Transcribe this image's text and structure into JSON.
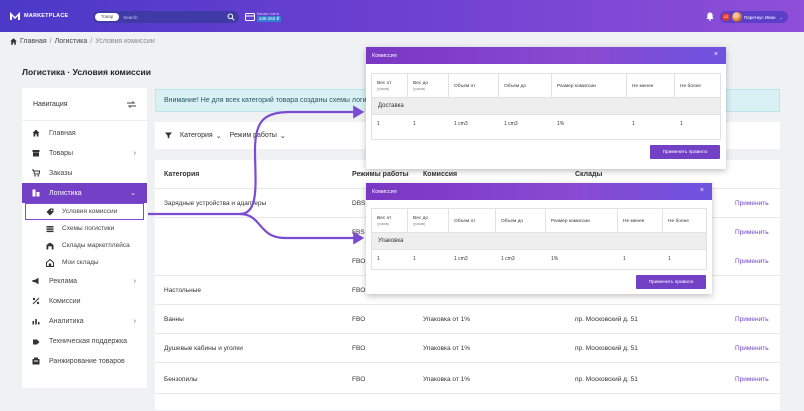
{
  "header": {
    "logo_text": "MARKETPLACE",
    "search_pill": "Товар",
    "search_placeholder": "Search",
    "wallet_label": "Баланс счета",
    "wallet_value": "445 263 ₽",
    "user_badge": "12",
    "user_name": "Паретиус Иван"
  },
  "breadcrumb": {
    "home": "Главная",
    "sep1": "/",
    "item2": "Логистика",
    "sep2": "/",
    "item3": "Условия комиссии"
  },
  "page_title": "Логистика · Условия комиссии",
  "sidebar": {
    "heading": "Навигация",
    "items": [
      {
        "label": "Главная",
        "icon": "home-icon"
      },
      {
        "label": "Товары",
        "icon": "box-icon",
        "chevron": "›"
      },
      {
        "label": "Заказы",
        "icon": "cart-icon"
      },
      {
        "label": "Логистика",
        "icon": "logistics-icon",
        "chevron": "⌄"
      },
      {
        "label": "Реклама",
        "icon": "megaphone-icon",
        "chevron": "›"
      },
      {
        "label": "Комиссии",
        "icon": "percent-icon"
      },
      {
        "label": "Аналитика",
        "icon": "chart-icon",
        "chevron": "›"
      },
      {
        "label": "Техническая поддержка",
        "icon": "support-icon"
      },
      {
        "label": "Ранжирование товаров",
        "icon": "ranking-icon"
      }
    ],
    "subitems": [
      {
        "label": "Условия комиссии",
        "icon": "tag-icon"
      },
      {
        "label": "Схемы логистики",
        "icon": "scheme-icon"
      },
      {
        "label": "Склады маркетплейса",
        "icon": "warehouse-icon"
      },
      {
        "label": "Мои склады",
        "icon": "my-warehouse-icon"
      }
    ]
  },
  "alert_text": "Внимание! Не для всех категорий товара созданы схемы логистики",
  "filters": {
    "category": "Категория",
    "mode": "Режим работы",
    "caret": "⌄"
  },
  "table": {
    "headers": [
      "Категория",
      "Режимы работы",
      "Комиссия",
      "Склады",
      ""
    ],
    "rows": [
      {
        "category": "Зарядные устройства и адаптеры",
        "mode": "DBS",
        "commission": "",
        "warehouse": "",
        "action": "Применить"
      },
      {
        "category": "",
        "mode": "FBS",
        "commission": "",
        "warehouse": "",
        "action": "Применить"
      },
      {
        "category": "",
        "mode": "FBO",
        "commission": "",
        "warehouse": "",
        "action": "Применить"
      },
      {
        "category": "Настольные",
        "mode": "FBO",
        "commission": "",
        "warehouse": "",
        "action": ""
      },
      {
        "category": "Ванны",
        "mode": "FBO",
        "commission": "Упаковка от 1%",
        "warehouse": "пр. Московский д. 51",
        "action": "Применить"
      },
      {
        "category": "Душевые кабины и уголки",
        "mode": "FBO",
        "commission": "Упаковка от 1%",
        "warehouse": "пр. Московский д. 51",
        "action": "Применить"
      },
      {
        "category": "Бензопилы",
        "mode": "FBO",
        "commission": "Упаковка от 1%",
        "warehouse": "пр. Московский д. 51",
        "action": "Применить"
      }
    ]
  },
  "modal1": {
    "title": "Комиссия",
    "close": "×",
    "columns": [
      {
        "label": "Вес от",
        "sub": "(грамм)"
      },
      {
        "label": "Вес до",
        "sub": "(грамм)"
      },
      {
        "label": "Объем от",
        "sub": ""
      },
      {
        "label": "Объем до",
        "sub": ""
      },
      {
        "label": "Размер комиссии",
        "sub": ""
      },
      {
        "label": "Не менее",
        "sub": ""
      },
      {
        "label": "Не более",
        "sub": ""
      }
    ],
    "section": "Доставка",
    "row": [
      "1",
      "1",
      "1 cm3",
      "1 cm3",
      "1%",
      "1",
      "1"
    ],
    "button": "Применить правило"
  },
  "modal2": {
    "title": "Комиссия",
    "close": "×",
    "columns": [
      {
        "label": "Вес от",
        "sub": "(грамм)"
      },
      {
        "label": "Вес до",
        "sub": "(грамм)"
      },
      {
        "label": "Объем от",
        "sub": ""
      },
      {
        "label": "Объем до",
        "sub": ""
      },
      {
        "label": "Размер комиссии",
        "sub": ""
      },
      {
        "label": "Не менее",
        "sub": ""
      },
      {
        "label": "Не более",
        "sub": ""
      }
    ],
    "section": "Упаковка",
    "row": [
      "1",
      "1",
      "1 cm3",
      "1 cm3",
      "1%",
      "1",
      "1"
    ],
    "button": "Применить правило"
  },
  "colors": {
    "accent": "#7441c6",
    "header_start": "#4a39c7",
    "header_end": "#8f4fd8",
    "arrow": "#7b4bd3"
  }
}
